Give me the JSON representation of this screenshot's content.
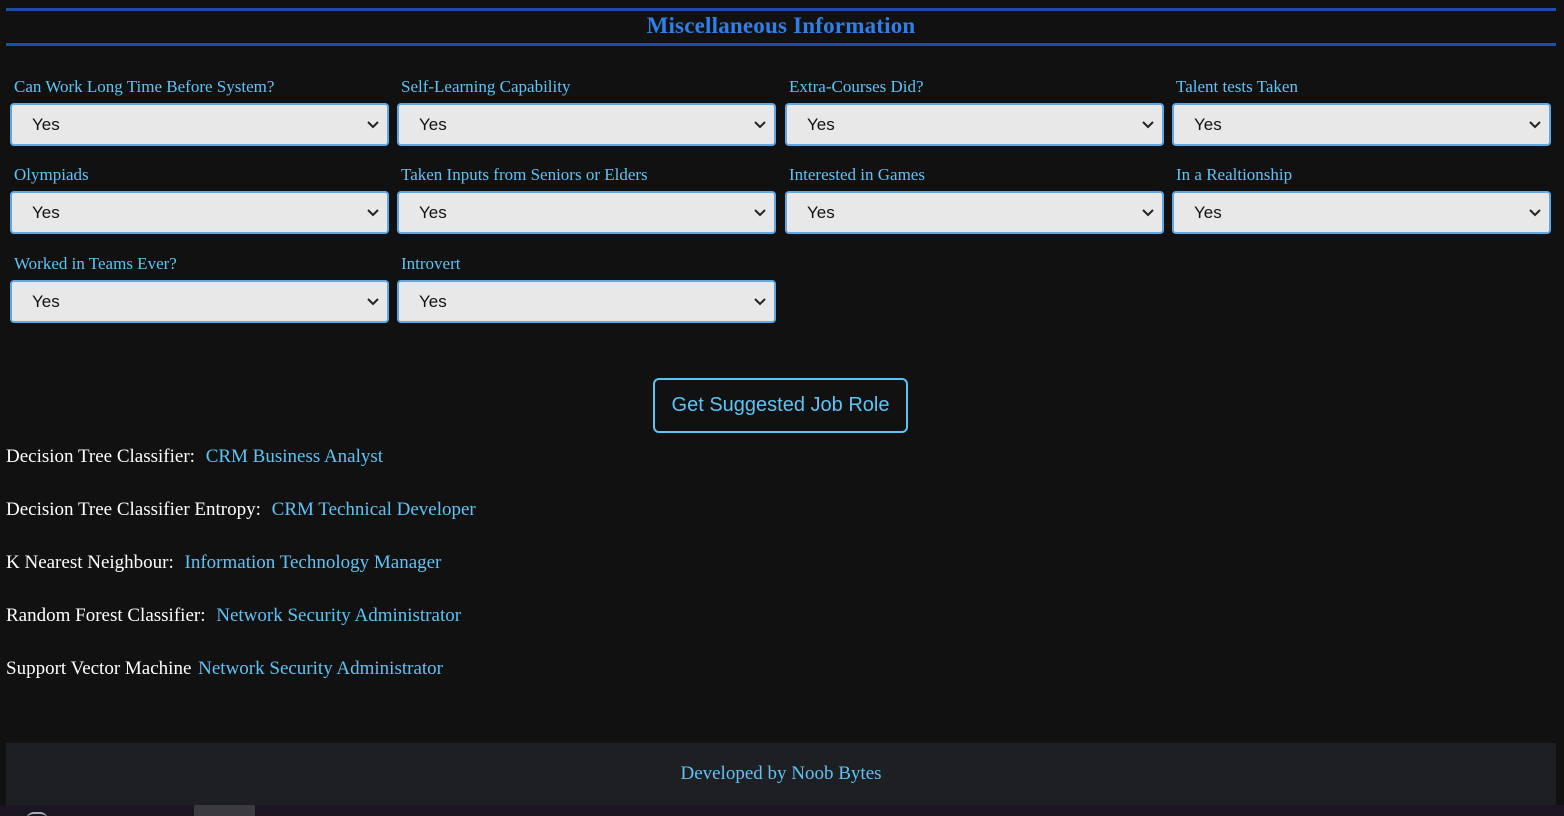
{
  "section": {
    "title": "Miscellaneous Information"
  },
  "fields": [
    {
      "label": "Can Work Long Time Before System?",
      "value": "Yes"
    },
    {
      "label": "Self-Learning Capability",
      "value": "Yes"
    },
    {
      "label": "Extra-Courses Did?",
      "value": "Yes"
    },
    {
      "label": "Talent tests Taken",
      "value": "Yes"
    },
    {
      "label": "Olympiads",
      "value": "Yes"
    },
    {
      "label": "Taken Inputs from Seniors or Elders",
      "value": "Yes"
    },
    {
      "label": "Interested in Games",
      "value": "Yes"
    },
    {
      "label": "In a Realtionship",
      "value": "Yes"
    },
    {
      "label": "Worked in Teams Ever?",
      "value": "Yes"
    },
    {
      "label": "Introvert",
      "value": "Yes"
    }
  ],
  "submit_button": {
    "label": "Get Suggested Job Role"
  },
  "results": [
    {
      "label": "Decision Tree Classifier:",
      "value": "CRM Business Analyst"
    },
    {
      "label": "Decision Tree Classifier Entropy:",
      "value": "CRM Technical Developer"
    },
    {
      "label": "K Nearest Neighbour:",
      "value": "Information Technology Manager"
    },
    {
      "label": "Random Forest Classifier:",
      "value": "Network Security Administrator"
    },
    {
      "label": "Support Vector Machine",
      "value": "Network Security Administrator"
    }
  ],
  "footer": {
    "text": "Developed by Noob Bytes"
  },
  "colors": {
    "background": "#111111",
    "accent": "#5fc3f5",
    "header": "#2f7fe8",
    "header_border": "#1e4fa8"
  }
}
